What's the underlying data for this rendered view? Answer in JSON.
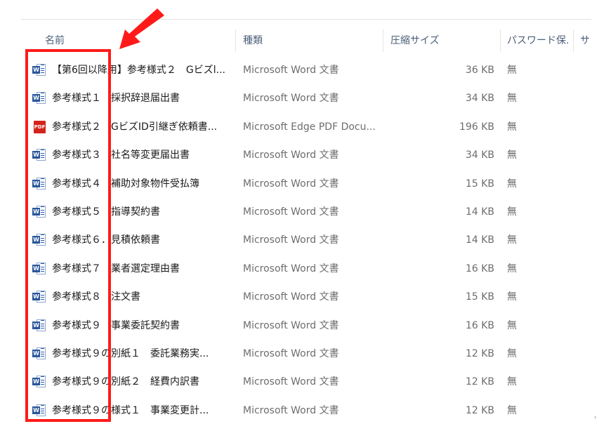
{
  "columns": {
    "name": "名前",
    "type": "種類",
    "size": "圧縮サイズ",
    "password": "パスワード保...",
    "extra": "サ"
  },
  "rows": [
    {
      "icon": "word",
      "name": "【第6回以降用】参考様式２　Gビズl...",
      "type": "Microsoft Word 文書",
      "size": "36 KB",
      "password": "無"
    },
    {
      "icon": "word",
      "name": "参考様式１　採択辞退届出書",
      "type": "Microsoft Word 文書",
      "size": "34 KB",
      "password": "無"
    },
    {
      "icon": "pdf",
      "name": "参考様式２　GビズID引継ぎ依頼書...",
      "type": "Microsoft Edge PDF Docu...",
      "size": "196 KB",
      "password": "無"
    },
    {
      "icon": "word",
      "name": "参考様式３　社名等変更届出書",
      "type": "Microsoft Word 文書",
      "size": "34 KB",
      "password": "無"
    },
    {
      "icon": "word",
      "name": "参考様式４　補助対象物件受払簿",
      "type": "Microsoft Word 文書",
      "size": "15 KB",
      "password": "無"
    },
    {
      "icon": "word",
      "name": "参考様式５　指導契約書",
      "type": "Microsoft Word 文書",
      "size": "14 KB",
      "password": "無"
    },
    {
      "icon": "word",
      "name": "参考様式６．見積依頼書",
      "type": "Microsoft Word 文書",
      "size": "14 KB",
      "password": "無"
    },
    {
      "icon": "word",
      "name": "参考様式７　業者選定理由書",
      "type": "Microsoft Word 文書",
      "size": "16 KB",
      "password": "無"
    },
    {
      "icon": "word",
      "name": "参考様式８　注文書",
      "type": "Microsoft Word 文書",
      "size": "15 KB",
      "password": "無"
    },
    {
      "icon": "word",
      "name": "参考様式９　事業委託契約書",
      "type": "Microsoft Word 文書",
      "size": "16 KB",
      "password": "無"
    },
    {
      "icon": "word",
      "name": "参考様式９の別紙１　委託業務実...",
      "type": "Microsoft Word 文書",
      "size": "12 KB",
      "password": "無"
    },
    {
      "icon": "word",
      "name": "参考様式９の別紙２　経費内訳書",
      "type": "Microsoft Word 文書",
      "size": "12 KB",
      "password": "無"
    },
    {
      "icon": "word",
      "name": "参考様式９の様式１　事業変更計...",
      "type": "Microsoft Word 文書",
      "size": "12 KB",
      "password": "無"
    }
  ],
  "icons": {
    "word_badge": "W",
    "pdf_label": "PDF"
  },
  "colors": {
    "highlight": "#ff1a1a",
    "word_blue": "#2b579a",
    "pdf_red": "#d3241c"
  }
}
